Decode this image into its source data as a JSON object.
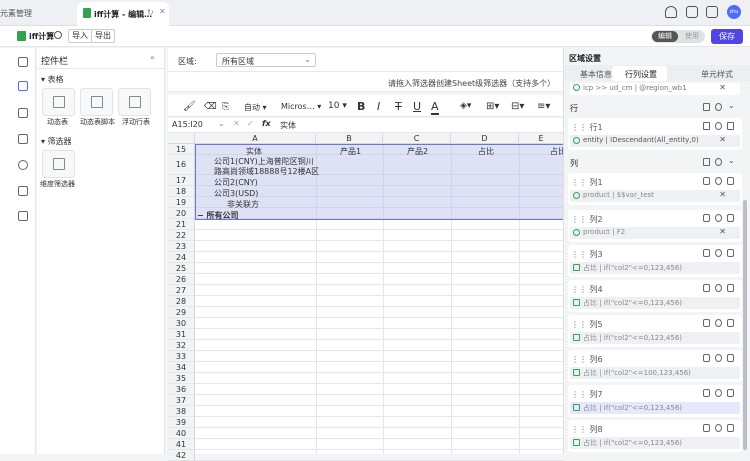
{
  "tabs": {
    "left_label": "元素管理",
    "active_title": "iff计算 - 编辑…",
    "refresh_icon": "↻",
    "close_icon": "✕"
  },
  "user": {
    "avatar_text": "zhu"
  },
  "toolbar": {
    "app_name": "iff计算",
    "import_label": "导入",
    "export_label": "导出",
    "mode_edit": "编辑",
    "mode_use": "使用",
    "save_label": "保存"
  },
  "control_panel": {
    "title": "控件栏",
    "collapse_icon": "«",
    "section_table": "表格",
    "tiles": [
      {
        "label": "动态表"
      },
      {
        "label": "动态表脚本"
      },
      {
        "label": "浮动行表"
      }
    ],
    "section_filter": "筛选器",
    "filter_tile": "维度筛选器"
  },
  "region": {
    "label": "区域:",
    "select_value": "所有区域",
    "hint": "请拖入筛选器创建Sheet级筛选器（支持多个）"
  },
  "format": {
    "auto_label": "自动",
    "font_label": "Micros…",
    "size_label": "10"
  },
  "formula_bar": {
    "cell_ref": "A15:I20",
    "fx": "fx",
    "value": "实体"
  },
  "grid": {
    "columns": [
      "A",
      "B",
      "C",
      "D",
      "E"
    ],
    "rows": [
      "15",
      "16",
      "17",
      "18",
      "19",
      "20",
      "21",
      "22",
      "23",
      "24",
      "25",
      "26",
      "27",
      "28",
      "29",
      "30",
      "31",
      "32",
      "33",
      "34",
      "35",
      "36",
      "37",
      "38",
      "39",
      "40",
      "41",
      "42"
    ],
    "cells": {
      "r15": [
        "实体",
        "产品1",
        "产品2",
        "占比",
        "占比"
      ],
      "r16a": "公司1(CNY)上海普陀区铜川",
      "r16b": "路高尚领域18888号12楼A区",
      "r17": "公司2(CNY)",
      "r18": "公司3(USD)",
      "r19": "非关联方",
      "r20": "− 所有公司"
    }
  },
  "right_panel": {
    "title": "区域设置",
    "tabs": [
      "基本信息",
      "行列设置",
      "单元样式"
    ],
    "top_chip": "icp >> ud_cm | @region_wb1",
    "row_section": "行",
    "row_item": {
      "label": "行1",
      "chip": "entity | IDescendant(All_entity,0)"
    },
    "col_section": "列",
    "cols": [
      {
        "label": "列1",
        "chip": "product | $$var_test",
        "type": "dim"
      },
      {
        "label": "列2",
        "chip": "product | F2",
        "type": "dim"
      },
      {
        "label": "列3",
        "chip": "占比 | if(\"col2\"<=0,123,456)",
        "type": "calc"
      },
      {
        "label": "列4",
        "chip": "占比 | if(\"col2\"<=0,123,456)",
        "type": "calc"
      },
      {
        "label": "列5",
        "chip": "占比 | if(\"col2\"<=0,123,456)",
        "type": "calc"
      },
      {
        "label": "列6",
        "chip": "占比 | if(\"col2\"<=100,123,456)",
        "type": "calc"
      },
      {
        "label": "列7",
        "chip": "占比 | if(\"col2\"<=0,123,456)",
        "type": "calc"
      },
      {
        "label": "列8",
        "chip": "占比 | if(\"col2\"<=0,123,456)",
        "type": "calc"
      }
    ]
  }
}
